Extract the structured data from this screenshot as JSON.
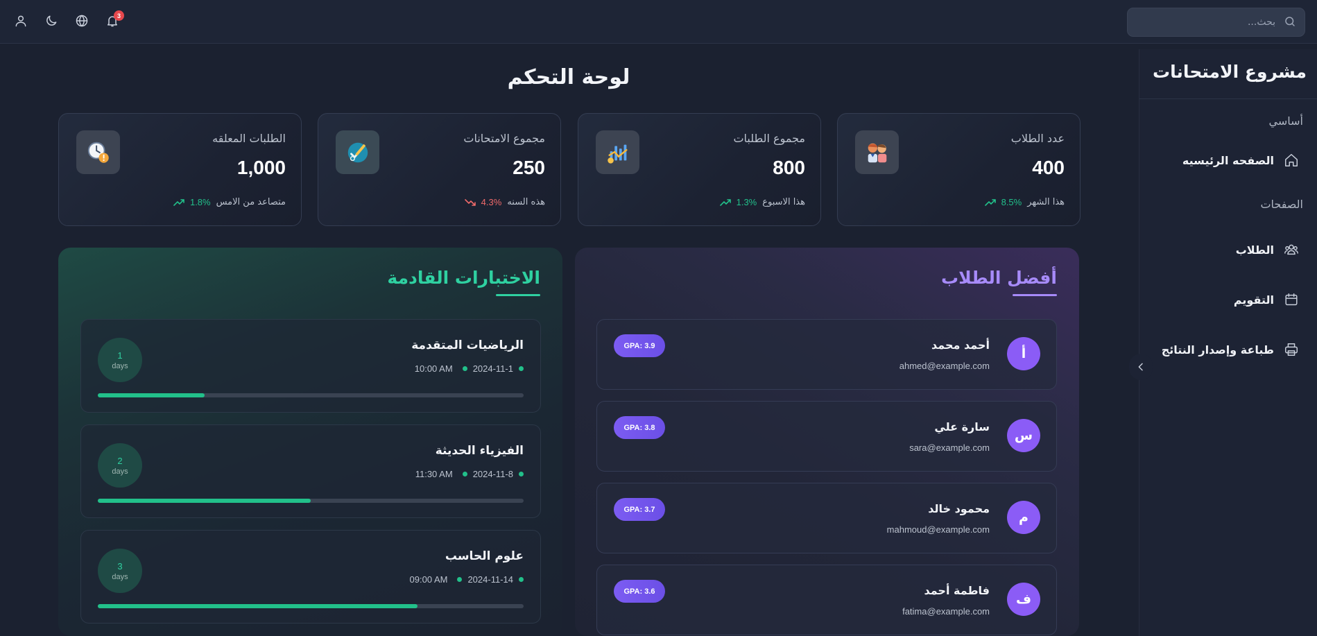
{
  "topbar": {
    "search_placeholder": "بحث...",
    "notifications_count": "3",
    "icons": [
      "user-icon",
      "moon-icon",
      "globe-icon",
      "bell-icon",
      "search-icon"
    ]
  },
  "sidebar": {
    "brand": "مشروع الامتحانات",
    "section_basic": "أساسي",
    "section_pages": "الصفحات",
    "items": [
      {
        "label": "الصفحه الرئيسيه",
        "icon": "home-icon"
      },
      {
        "label": "الطلاب",
        "icon": "users-icon"
      },
      {
        "label": "التقويم",
        "icon": "calendar-icon"
      },
      {
        "label": "طباعة وإصدار النتائج",
        "icon": "printer-icon"
      }
    ]
  },
  "main": {
    "title": "لوحة التحكم",
    "stats": [
      {
        "label": "عدد الطلاب",
        "value": "400",
        "pct": "8.5%",
        "period": "هذا الشهر",
        "trend": "up",
        "icon": "students-icon"
      },
      {
        "label": "مجموع الطلبات",
        "value": "800",
        "pct": "1.3%",
        "period": "هذا الاسبوع",
        "trend": "up",
        "icon": "chart-growth-icon"
      },
      {
        "label": "مجموع الامتحانات",
        "value": "250",
        "pct": "4.3%",
        "period": "هذه السنه",
        "trend": "down",
        "icon": "exam-check-icon"
      },
      {
        "label": "الطلبات المعلقه",
        "value": "1,000",
        "pct": "1.8%",
        "period": "متصاعد من الامس",
        "trend": "up",
        "icon": "pending-clock-icon"
      }
    ],
    "colors": {
      "up": "#22c08a",
      "down": "#f06a6a",
      "accent_green": "#2fd1a1",
      "accent_purple": "#a78bfa"
    },
    "upcoming": {
      "title": "الاختبارات القادمة",
      "exams": [
        {
          "name": "الرياضيات المتقدمة",
          "date": "2024-11-1",
          "time": "10:00 AM",
          "days": "1",
          "days_label": "days",
          "progress": 0.25
        },
        {
          "name": "الفيزياء الحديثة",
          "date": "2024-11-8",
          "time": "11:30 AM",
          "days": "2",
          "days_label": "days",
          "progress": 0.5
        },
        {
          "name": "علوم الحاسب",
          "date": "2024-11-14",
          "time": "09:00 AM",
          "days": "3",
          "days_label": "days",
          "progress": 0.75
        }
      ]
    },
    "top_students": {
      "title": "أفضل الطلاب",
      "students": [
        {
          "initial": "أ",
          "name": "أحمد محمد",
          "email": "ahmed@example.com",
          "gpa": "GPA: 3.9"
        },
        {
          "initial": "س",
          "name": "سارة علي",
          "email": "sara@example.com",
          "gpa": "GPA: 3.8"
        },
        {
          "initial": "م",
          "name": "محمود خالد",
          "email": "mahmoud@example.com",
          "gpa": "GPA: 3.7"
        },
        {
          "initial": "ف",
          "name": "فاطمة أحمد",
          "email": "fatima@example.com",
          "gpa": "GPA: 3.6"
        }
      ]
    }
  }
}
